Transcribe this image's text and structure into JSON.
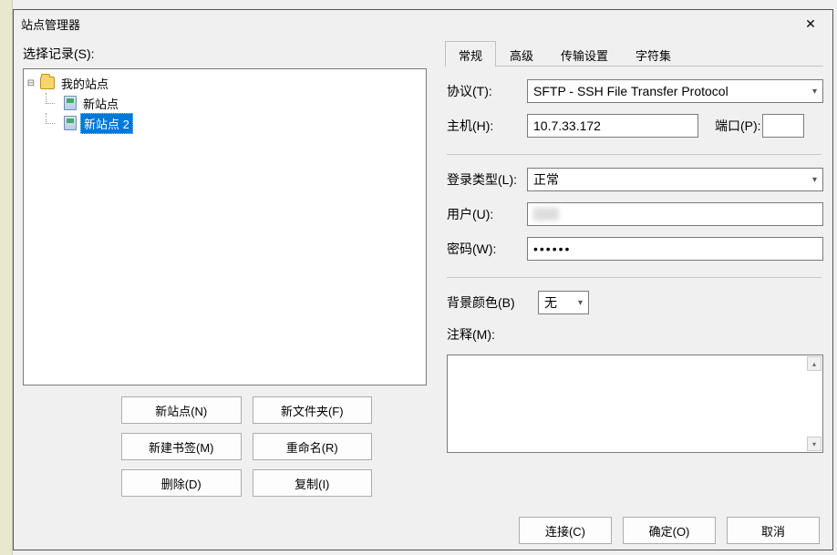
{
  "window": {
    "title": "站点管理器"
  },
  "left": {
    "select_label": "选择记录(S):",
    "tree": {
      "root": "我的站点",
      "items": [
        "新站点",
        "新站点 2"
      ],
      "selected": 1
    },
    "buttons": {
      "new_site": "新站点(N)",
      "new_folder": "新文件夹(F)",
      "new_bookmark": "新建书签(M)",
      "rename": "重命名(R)",
      "delete": "删除(D)",
      "duplicate": "复制(I)"
    }
  },
  "tabs": [
    "常规",
    "高级",
    "传输设置",
    "字符集"
  ],
  "active_tab": 0,
  "form": {
    "protocol_label": "协议(T):",
    "protocol_value": "SFTP - SSH File Transfer Protocol",
    "host_label": "主机(H):",
    "host_value": "10.7.33.172",
    "port_label": "端口(P):",
    "port_value": "",
    "logon_type_label": "登录类型(L):",
    "logon_type_value": "正常",
    "user_label": "用户(U):",
    "user_value": "",
    "password_label": "密码(W):",
    "password_value": "••••••",
    "bgcolor_label": "背景颜色(B)",
    "bgcolor_value": "无",
    "comment_label": "注释(M):",
    "comment_value": ""
  },
  "dialog_buttons": {
    "connect": "连接(C)",
    "ok": "确定(O)",
    "cancel": "取消"
  }
}
